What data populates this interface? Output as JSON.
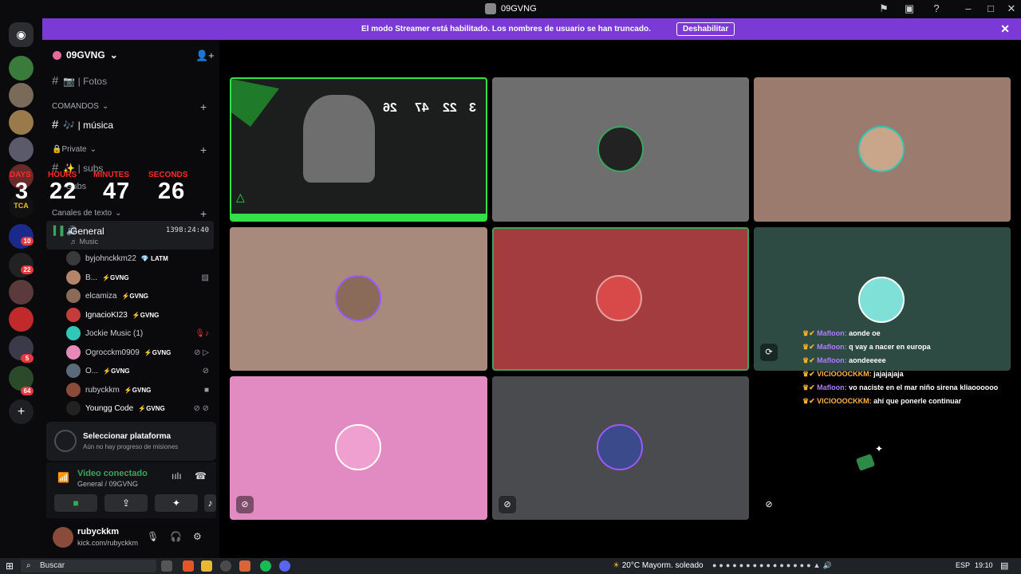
{
  "window": {
    "title": "09GVNG"
  },
  "banner": {
    "message": "El modo Streamer está habilitado. Los nombres de usuario se han truncado.",
    "button": "Deshabilitar",
    "close": "✕"
  },
  "rail": {
    "badges": [
      "10",
      "22",
      "5",
      "64"
    ],
    "server_labels": [
      "TCA"
    ]
  },
  "server": {
    "name": "09GVNG",
    "chevron": "⌄"
  },
  "channels": {
    "fotos": "📷 | Fotos",
    "cat_comandos": "COMANDOS",
    "musica": "🎶 | música",
    "cat_private": "🔒Private",
    "subs": "✨ | subs",
    "subs2": "Subs",
    "cat_texto": "Canales de texto"
  },
  "timer": {
    "days_label": "DAYS",
    "hours_label": "HOURS",
    "minutes_label": "MINUTES",
    "seconds_label": "SECONDS",
    "days": "3",
    "hours": "22",
    "minutes": "47",
    "seconds": "26"
  },
  "voice_channel": {
    "name": "General",
    "sub": "♬ Music",
    "time": "1398:24:40"
  },
  "members": [
    {
      "name": "byjohnckkm22",
      "tag": "💎 LATM",
      "color": "#3a3a3a"
    },
    {
      "name": "B...",
      "tag": "⚡GVNG",
      "color": "#b5856a"
    },
    {
      "name": "elcamiza",
      "tag": "⚡GVNG",
      "color": "#8a6b5a"
    },
    {
      "name": "IgnacioKI23",
      "tag": "⚡GVNG",
      "color": "#c43c3c"
    },
    {
      "name": "Jockie Music (1)",
      "tag": "",
      "color": "#2fc7b5"
    },
    {
      "name": "Ogrocckm0909",
      "tag": "⚡GVNG",
      "color": "#e58ab8"
    },
    {
      "name": "O...",
      "tag": "⚡GVNG",
      "color": "#5a6a7a"
    },
    {
      "name": "rubyckkm",
      "tag": "⚡GVNG",
      "color": "#8b4b3a"
    },
    {
      "name": "Youngg Code",
      "tag": "⚡GVNG",
      "color": "#222"
    }
  ],
  "mission": {
    "title": "Seleccionar plataforma",
    "sub": "Aún no hay progreso de misiones"
  },
  "voice_panel": {
    "status": "Video conectado",
    "channel": "General / 09GVNG"
  },
  "user": {
    "name": "rubyckkm",
    "status": "kick.com/rubyckkm"
  },
  "stream_overlay": {
    "n1": "26",
    "n2": "47",
    "n3": "22",
    "n4": "3"
  },
  "chat": [
    {
      "user": "Mafloon:",
      "text": "aonde oe",
      "style": "u1"
    },
    {
      "user": "Mafloon:",
      "text": "q vay a nacer en europa",
      "style": "u1"
    },
    {
      "user": "Mafloon:",
      "text": "aondeeeee",
      "style": "u1"
    },
    {
      "user": "VICIOOOCKKM:",
      "text": "jajajajaja",
      "style": "u2"
    },
    {
      "user": "Mafloon:",
      "text": "vo naciste en el mar niño sirena kliaoooooo",
      "style": "u1"
    },
    {
      "user": "VICIOOOCKKM:",
      "text": "ahí que ponerle continuar",
      "style": "u2"
    }
  ],
  "taskbar": {
    "search": "Buscar",
    "weather": "20°C  Mayorm. soleado",
    "lang": "ESP",
    "time": "19:10"
  },
  "colors": {
    "banner": "#7b3ad6",
    "tile_gray": "#6e6e6e",
    "tile_tan": "#9b7b6e",
    "tile_tan2": "#a78a7c",
    "tile_red": "#a33c3e",
    "tile_teal": "#2d4a43",
    "tile_pink": "#e28bc3",
    "tile_dark": "#4a4b4f",
    "accent_green": "#3ba55d"
  }
}
